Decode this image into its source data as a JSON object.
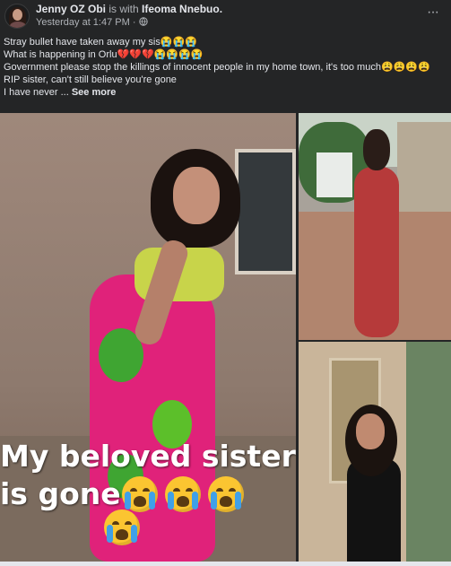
{
  "post": {
    "author": "Jenny OZ Obi",
    "with_text": " is with ",
    "tagged": "Ifeoma Nnebuo.",
    "timestamp": "Yesterday at 1:47 PM",
    "separator": " · ",
    "audience_icon": "globe-icon",
    "more_label": "···",
    "lines": [
      "Stray bullet have taken away my sis😭😭😭",
      "What is happening in Orlu💔💔💔😭😭😭😭",
      "Government please stop the killings of innocent people in my home town, it's too much😩😩😩😩",
      "RIP sister, can't still believe you're gone",
      "I have never ... "
    ],
    "see_more": "See more"
  },
  "photos": {
    "caption_line1": "My beloved sister",
    "caption_line2": "is gone"
  }
}
